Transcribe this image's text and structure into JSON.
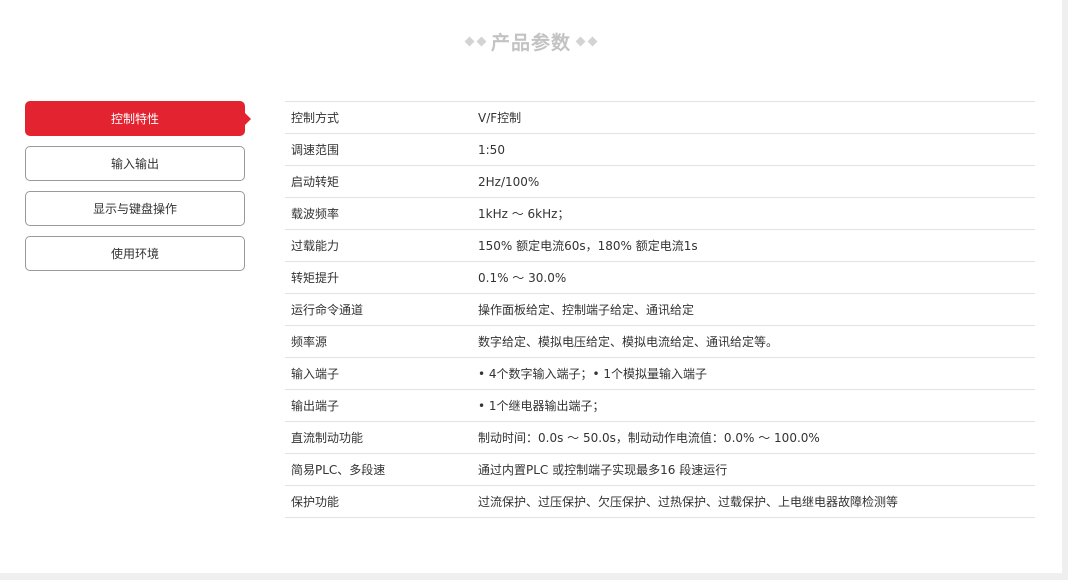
{
  "section": {
    "title": "产品参数"
  },
  "tabs": [
    {
      "label": "控制特性",
      "active": true
    },
    {
      "label": "输入输出",
      "active": false
    },
    {
      "label": "显示与键盘操作",
      "active": false
    },
    {
      "label": "使用环境",
      "active": false
    }
  ],
  "params": [
    {
      "name": "控制方式",
      "value": "V/F控制"
    },
    {
      "name": "调速范围",
      "value": "1:50"
    },
    {
      "name": "启动转矩",
      "value": "2Hz/100%"
    },
    {
      "name": "载波频率",
      "value": "1kHz ～ 6kHz；"
    },
    {
      "name": "过载能力",
      "value": "150% 额定电流60s，180% 额定电流1s"
    },
    {
      "name": "转矩提升",
      "value": "0.1% ～ 30.0%"
    },
    {
      "name": "运行命令通道",
      "value": "操作面板给定、控制端子给定、通讯给定"
    },
    {
      "name": "频率源",
      "value": "数字给定、模拟电压给定、模拟电流给定、通讯给定等。"
    },
    {
      "name": "输入端子",
      "value": "• 4个数字输入端子；• 1个模拟量输入端子"
    },
    {
      "name": "输出端子",
      "value": "• 1个继电器输出端子；"
    },
    {
      "name": "直流制动功能",
      "value": "制动时间：0.0s ～ 50.0s，制动动作电流值：0.0% ～ 100.0%"
    },
    {
      "name": "简易PLC、多段速",
      "value": "通过内置PLC 或控制端子实现最多16 段速运行"
    },
    {
      "name": "保护功能",
      "value": "过流保护、过压保护、欠压保护、过热保护、过载保护、上电继电器故障检测等"
    }
  ]
}
